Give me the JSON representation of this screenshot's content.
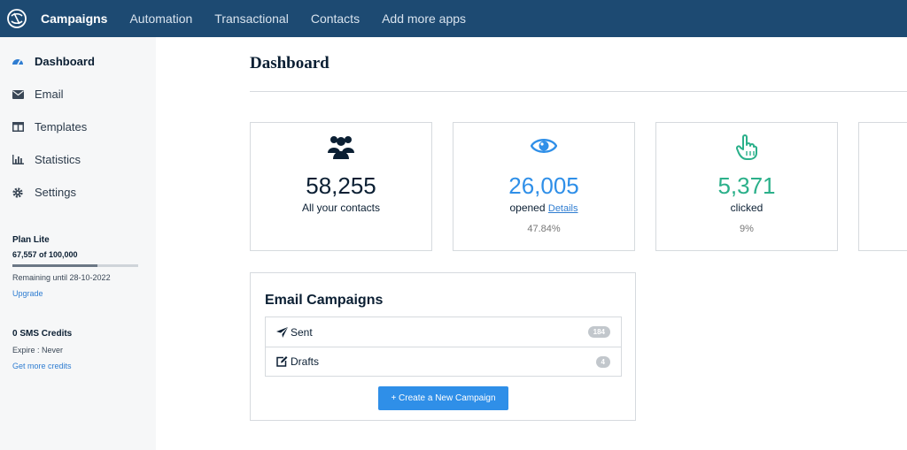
{
  "topnav": {
    "items": [
      {
        "label": "Campaigns",
        "active": true
      },
      {
        "label": "Automation"
      },
      {
        "label": "Transactional"
      },
      {
        "label": "Contacts"
      },
      {
        "label": "Add more apps"
      }
    ]
  },
  "sidebar": {
    "items": [
      {
        "label": "Dashboard",
        "icon": "speedometer-icon",
        "active": true
      },
      {
        "label": "Email",
        "icon": "envelope-icon"
      },
      {
        "label": "Templates",
        "icon": "columns-icon"
      },
      {
        "label": "Statistics",
        "icon": "bar-chart-icon"
      },
      {
        "label": "Settings",
        "icon": "gear-icon"
      }
    ],
    "plan": {
      "title": "Plan Lite",
      "usage": "67,557 of 100,000",
      "used_fraction": 0.6756,
      "remaining": "Remaining until 28-10-2022",
      "upgrade": "Upgrade"
    },
    "sms": {
      "title": "0 SMS Credits",
      "expire": "Expire : Never",
      "link": "Get more credits"
    }
  },
  "main": {
    "title": "Dashboard",
    "cards": [
      {
        "value": "58,255",
        "caption": "All your contacts",
        "icon": "users-icon"
      },
      {
        "value": "26,005",
        "caption": "opened",
        "link": "Details",
        "percent": "47.84%",
        "icon": "eye-icon",
        "color": "#2f8fe8"
      },
      {
        "value": "5,371",
        "caption": "clicked",
        "percent": "9%",
        "icon": "pointer-hand-icon",
        "color": "#2bb08a"
      }
    ],
    "email_campaigns": {
      "title": "Email Campaigns",
      "rows": [
        {
          "label": "Sent",
          "count": "184",
          "icon": "paper-plane-icon"
        },
        {
          "label": "Drafts",
          "count": "4",
          "icon": "edit-icon"
        }
      ],
      "create_button": "+ Create a New Campaign"
    }
  }
}
